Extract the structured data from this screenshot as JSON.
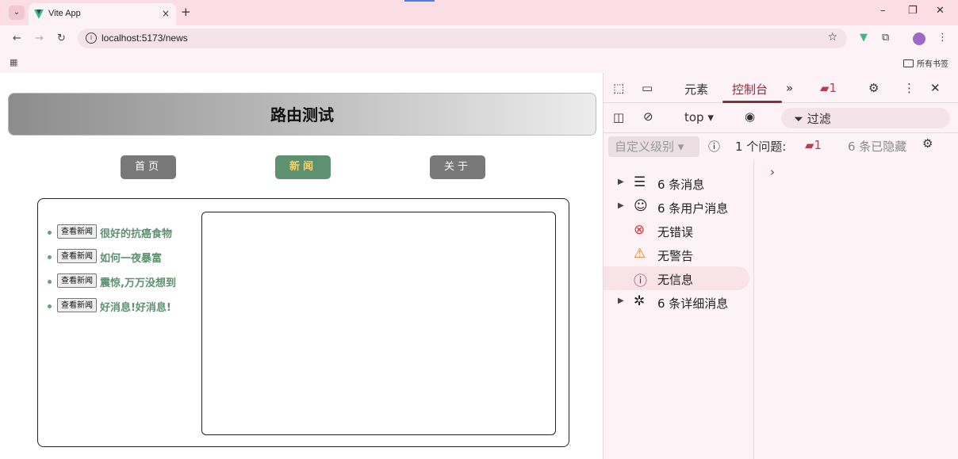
{
  "browser": {
    "tab_title": "Vite App",
    "tab_close": "×",
    "new_tab": "+",
    "url": "localhost:5173/news",
    "bookmarks_folder": "所有书签",
    "window_controls": [
      "–",
      "❐",
      "✕"
    ]
  },
  "app": {
    "title": "路由测试",
    "nav": [
      {
        "label": "首页",
        "active": false
      },
      {
        "label": "新闻",
        "active": true
      },
      {
        "label": "关于",
        "active": false
      }
    ],
    "view_button_label": "查看新闻",
    "news": [
      {
        "title": "很好的抗癌食物"
      },
      {
        "title": "如何一夜暴富"
      },
      {
        "title": "震惊,万万没想到"
      },
      {
        "title": "好消息!好消息!"
      }
    ]
  },
  "devtools": {
    "tabs": {
      "elements": "元素",
      "console": "控制台",
      "more": "»",
      "issue_count": "1"
    },
    "filterbar": {
      "context": "top",
      "filter_placeholder": "过滤"
    },
    "levelbar": {
      "level_select": "自定义级别",
      "issues_text": "1 个问题:",
      "issues_count": "1",
      "hidden_text": "6 条已隐藏"
    },
    "sidebar": [
      {
        "icon": "list-icon",
        "label": "6 条消息",
        "expandable": true,
        "selected": false
      },
      {
        "icon": "user-icon",
        "label": "6 条用户消息",
        "expandable": true,
        "selected": false
      },
      {
        "icon": "error-icon",
        "label": "无错误",
        "expandable": false,
        "selected": false
      },
      {
        "icon": "warning-icon",
        "label": "无警告",
        "expandable": false,
        "selected": false
      },
      {
        "icon": "info-icon",
        "label": "无信息",
        "expandable": false,
        "selected": true
      },
      {
        "icon": "bug-icon",
        "label": "6 条详细消息",
        "expandable": true,
        "selected": false
      }
    ],
    "prompt": "›"
  },
  "colors": {
    "accent_green": "#5d9170",
    "nav_gray": "#787878",
    "active_nav_text": "#f6d36b",
    "devtools_accent": "#8a2d3b"
  }
}
